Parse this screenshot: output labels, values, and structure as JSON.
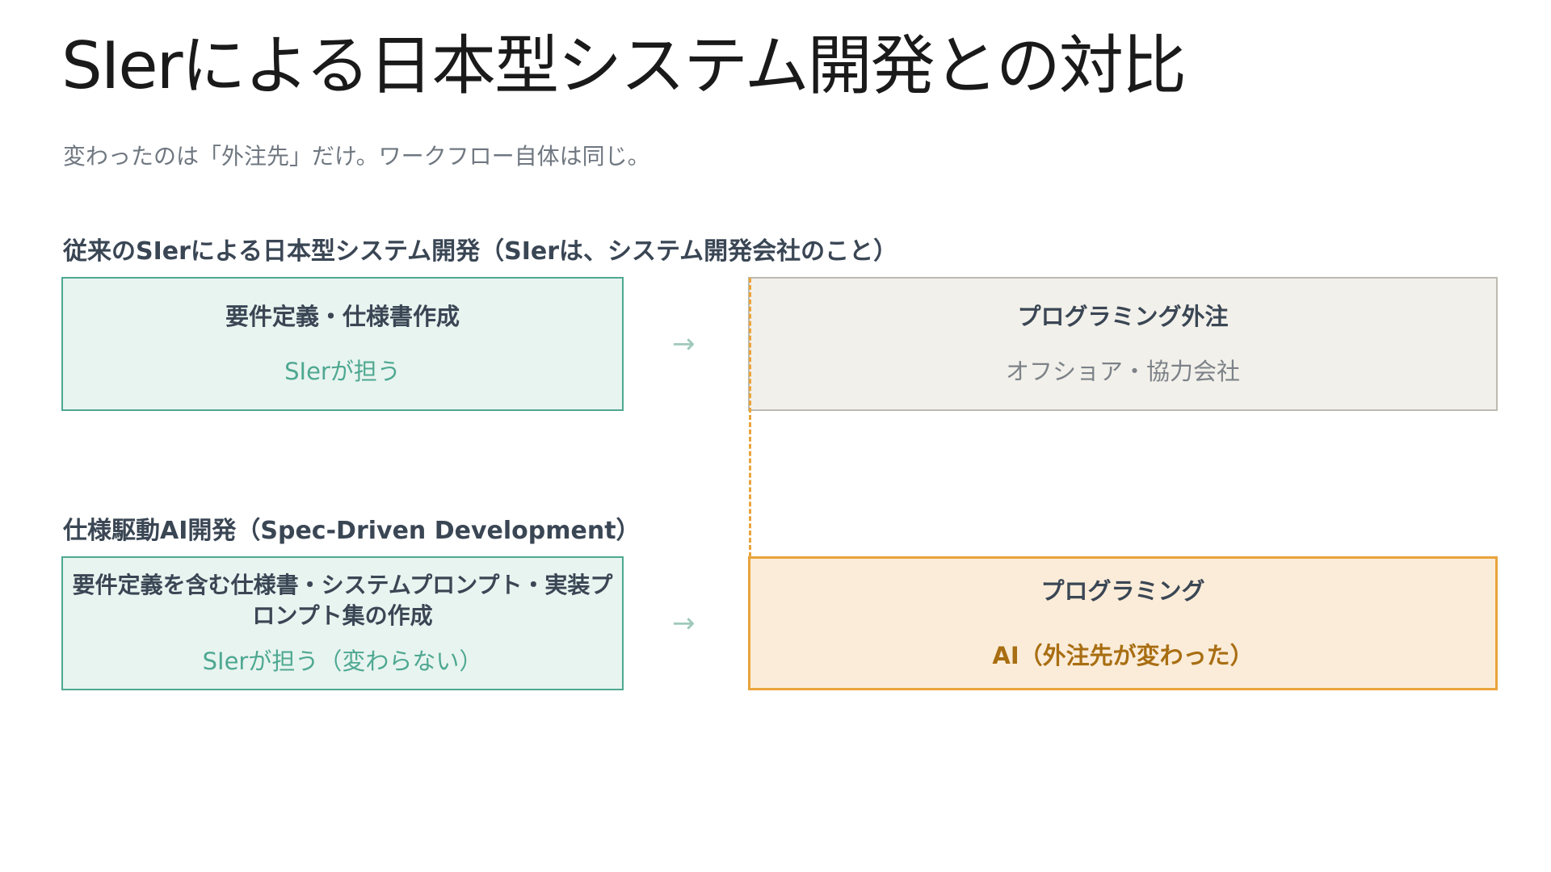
{
  "title": "SIerによる日本型システム開発との対比",
  "subtitle": "変わったのは「外注先」だけ。ワークフロー自体は同じ。",
  "traditional": {
    "label": "従来のSIerによる日本型システム開発（SIerは、システム開発会社のこと）",
    "left": {
      "heading": "要件定義・仕様書作成",
      "sub": "SIerが担う"
    },
    "arrow": "→",
    "right": {
      "heading": "プログラミング外注",
      "sub": "オフショア・協力会社"
    }
  },
  "sdd": {
    "label": "仕様駆動AI開発（Spec-Driven Development）",
    "left": {
      "heading": "要件定義を含む仕様書・システムプロンプト・実装プロンプト集の作成",
      "sub": "SIerが担う（変わらない）"
    },
    "arrow": "→",
    "right": {
      "heading": "プログラミング",
      "sub": "AI（外注先が変わった）"
    }
  },
  "colors": {
    "green_accent": "#4ea891",
    "orange_accent": "#e9a43b",
    "gray_border": "#bdbab2"
  }
}
